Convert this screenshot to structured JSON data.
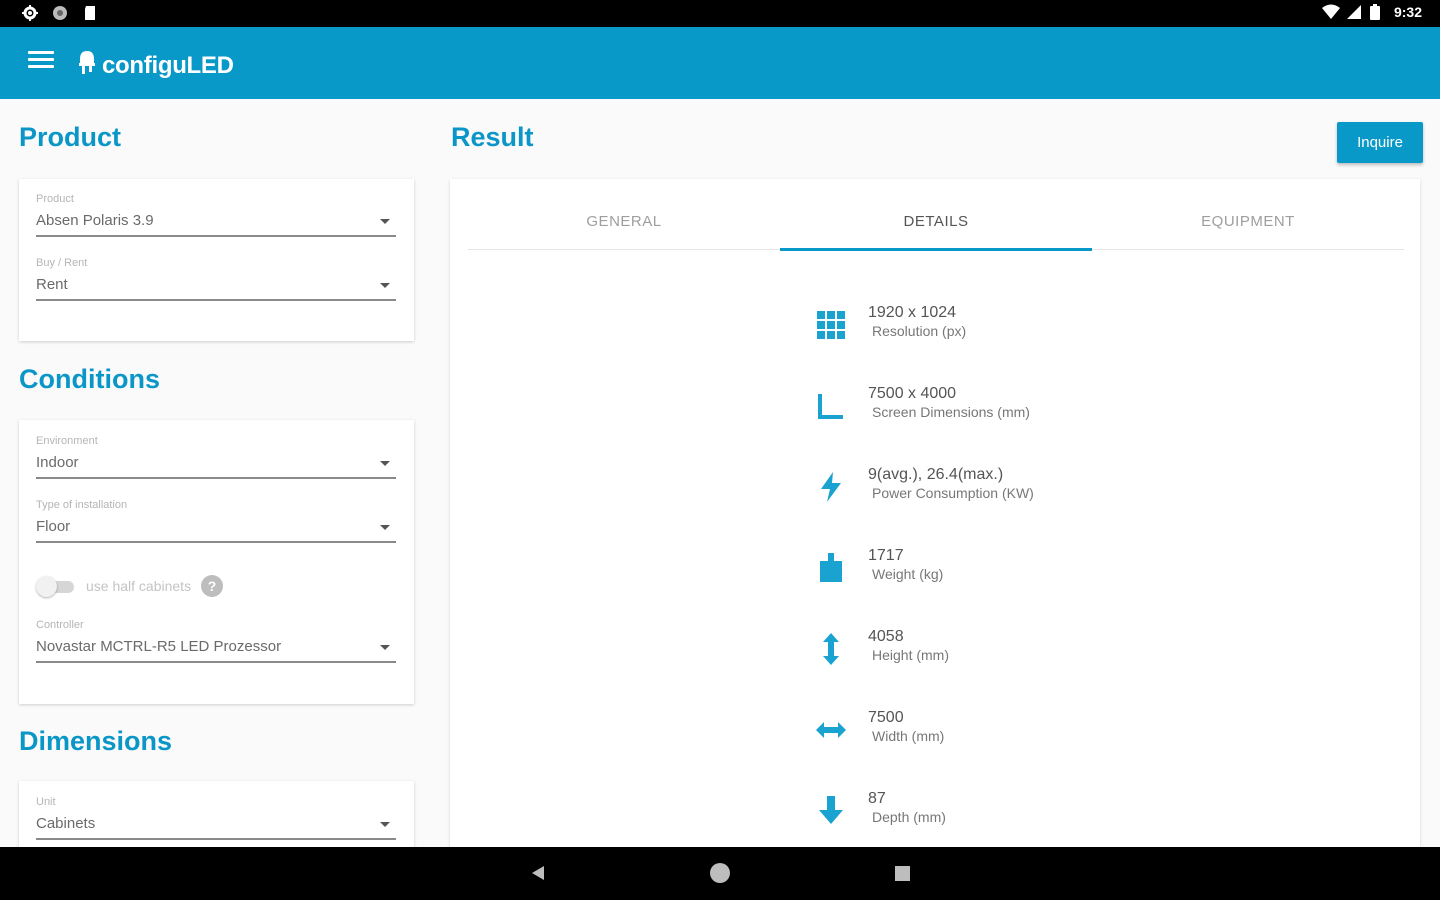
{
  "status_bar": {
    "time": "9:32",
    "left_icons": [
      "settings-icon",
      "circle-icon",
      "sd-card-icon"
    ],
    "right_icons": [
      "wifi-icon",
      "signal-icon",
      "battery-icon"
    ]
  },
  "app_bar": {
    "menu_icon": "menu-icon",
    "logo_icon": "led-icon",
    "title": "configuLED",
    "color": "#0899c9"
  },
  "product_section": {
    "title": "Product",
    "fields": [
      {
        "label": "Product",
        "value": "Absen Polaris 3.9"
      },
      {
        "label": "Buy / Rent",
        "value": "Rent"
      }
    ]
  },
  "conditions_section": {
    "title": "Conditions",
    "fields": [
      {
        "label": "Environment",
        "value": "Indoor"
      },
      {
        "label": "Type of installation",
        "value": "Floor"
      }
    ],
    "toggle": {
      "label": "use half cabinets",
      "on": false,
      "help_icon": "help-icon"
    },
    "controller": {
      "label": "Controller",
      "value": "Novastar MCTRL-R5 LED Prozessor"
    }
  },
  "dimensions_section": {
    "title": "Dimensions",
    "fields": [
      {
        "label": "Unit",
        "value": "Cabinets"
      }
    ]
  },
  "result": {
    "title": "Result",
    "inquire_label": "Inquire",
    "tabs": [
      {
        "label": "GENERAL",
        "active": false
      },
      {
        "label": "DETAILS",
        "active": true
      },
      {
        "label": "EQUIPMENT",
        "active": false
      }
    ],
    "details": [
      {
        "icon": "grid-icon",
        "value": "1920 x 1024",
        "label": "Resolution (px)"
      },
      {
        "icon": "corner-icon",
        "value": "7500 x 4000",
        "label": "Screen Dimensions (mm)"
      },
      {
        "icon": "lightning-icon",
        "value": "9(avg.), 26.4(max.)",
        "label": "Power Consumption (KW)"
      },
      {
        "icon": "weight-icon",
        "value": "1717",
        "label": "Weight (kg)"
      },
      {
        "icon": "vertical-arrows-icon",
        "value": "4058",
        "label": "Height (mm)"
      },
      {
        "icon": "horizontal-arrows-icon",
        "value": "7500",
        "label": "Width (mm)"
      },
      {
        "icon": "arrow-down-icon",
        "value": "87",
        "label": "Depth (mm)"
      }
    ]
  },
  "nav_bar": {
    "icons": [
      "back-icon",
      "home-icon",
      "recents-icon"
    ]
  },
  "colors": {
    "accent": "#0899c9",
    "section_title": "#0a97c8"
  }
}
